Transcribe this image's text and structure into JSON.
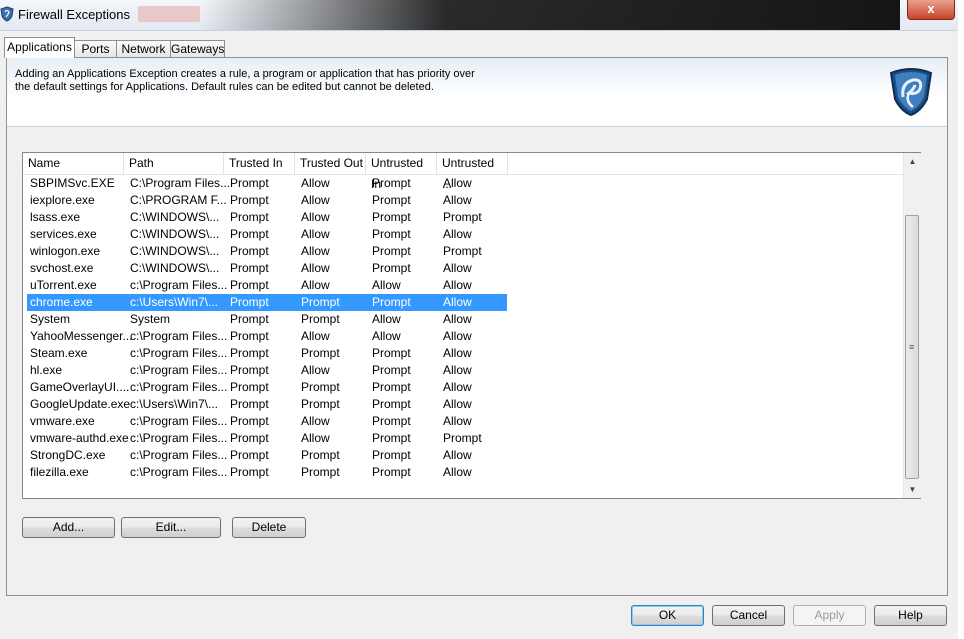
{
  "window": {
    "title": "Firewall Exceptions",
    "close_label": "x"
  },
  "tabs": [
    {
      "label": "Applications",
      "active": true
    },
    {
      "label": "Ports",
      "active": false
    },
    {
      "label": "Network",
      "active": false
    },
    {
      "label": "Gateways",
      "active": false
    }
  ],
  "header": {
    "description_line1": "Adding an Applications Exception creates a rule, a program or application that has priority over",
    "description_line2": "the default settings for Applications. Default rules can be edited but cannot be deleted.",
    "icon": "shield-cobra-icon"
  },
  "table": {
    "columns": [
      "Name",
      "Path",
      "Trusted In",
      "Trusted Out",
      "Untrusted In",
      "Untrusted ..."
    ],
    "rows": [
      [
        "SBPIMSvc.EXE",
        "C:\\Program Files...",
        "Prompt",
        "Allow",
        "Prompt",
        "Allow"
      ],
      [
        "iexplore.exe",
        "C:\\PROGRAM F...",
        "Prompt",
        "Allow",
        "Prompt",
        "Allow"
      ],
      [
        "lsass.exe",
        "C:\\WINDOWS\\...",
        "Prompt",
        "Allow",
        "Prompt",
        "Prompt"
      ],
      [
        "services.exe",
        "C:\\WINDOWS\\...",
        "Prompt",
        "Allow",
        "Prompt",
        "Allow"
      ],
      [
        "winlogon.exe",
        "C:\\WINDOWS\\...",
        "Prompt",
        "Allow",
        "Prompt",
        "Prompt"
      ],
      [
        "svchost.exe",
        "C:\\WINDOWS\\...",
        "Prompt",
        "Allow",
        "Prompt",
        "Allow"
      ],
      [
        "uTorrent.exe",
        "c:\\Program Files...",
        "Prompt",
        "Allow",
        "Allow",
        "Allow"
      ],
      [
        "chrome.exe",
        "c:\\Users\\Win7\\...",
        "Prompt",
        "Prompt",
        "Prompt",
        "Allow"
      ],
      [
        "System",
        "System",
        "Prompt",
        "Prompt",
        "Allow",
        "Allow"
      ],
      [
        "YahooMessenger...",
        "c:\\Program Files...",
        "Prompt",
        "Allow",
        "Allow",
        "Allow"
      ],
      [
        "Steam.exe",
        "c:\\Program Files...",
        "Prompt",
        "Prompt",
        "Prompt",
        "Allow"
      ],
      [
        "hl.exe",
        "c:\\Program Files...",
        "Prompt",
        "Allow",
        "Prompt",
        "Allow"
      ],
      [
        "GameOverlayUI....",
        "c:\\Program Files...",
        "Prompt",
        "Prompt",
        "Prompt",
        "Allow"
      ],
      [
        "GoogleUpdate.exe",
        "c:\\Users\\Win7\\...",
        "Prompt",
        "Prompt",
        "Prompt",
        "Allow"
      ],
      [
        "vmware.exe",
        "c:\\Program Files...",
        "Prompt",
        "Allow",
        "Prompt",
        "Allow"
      ],
      [
        "vmware-authd.exe",
        "c:\\Program Files...",
        "Prompt",
        "Allow",
        "Prompt",
        "Prompt"
      ],
      [
        "StrongDC.exe",
        "c:\\Program Files...",
        "Prompt",
        "Prompt",
        "Prompt",
        "Allow"
      ],
      [
        "filezilla.exe",
        "c:\\Program Files...",
        "Prompt",
        "Prompt",
        "Prompt",
        "Allow"
      ]
    ],
    "selected_row": 7
  },
  "actions": {
    "add": "Add...",
    "edit": "Edit...",
    "delete": "Delete"
  },
  "footer": {
    "ok": "OK",
    "cancel": "Cancel",
    "apply": "Apply",
    "help": "Help"
  },
  "colors": {
    "selection": "#3399ff",
    "close": "#c8432b"
  }
}
